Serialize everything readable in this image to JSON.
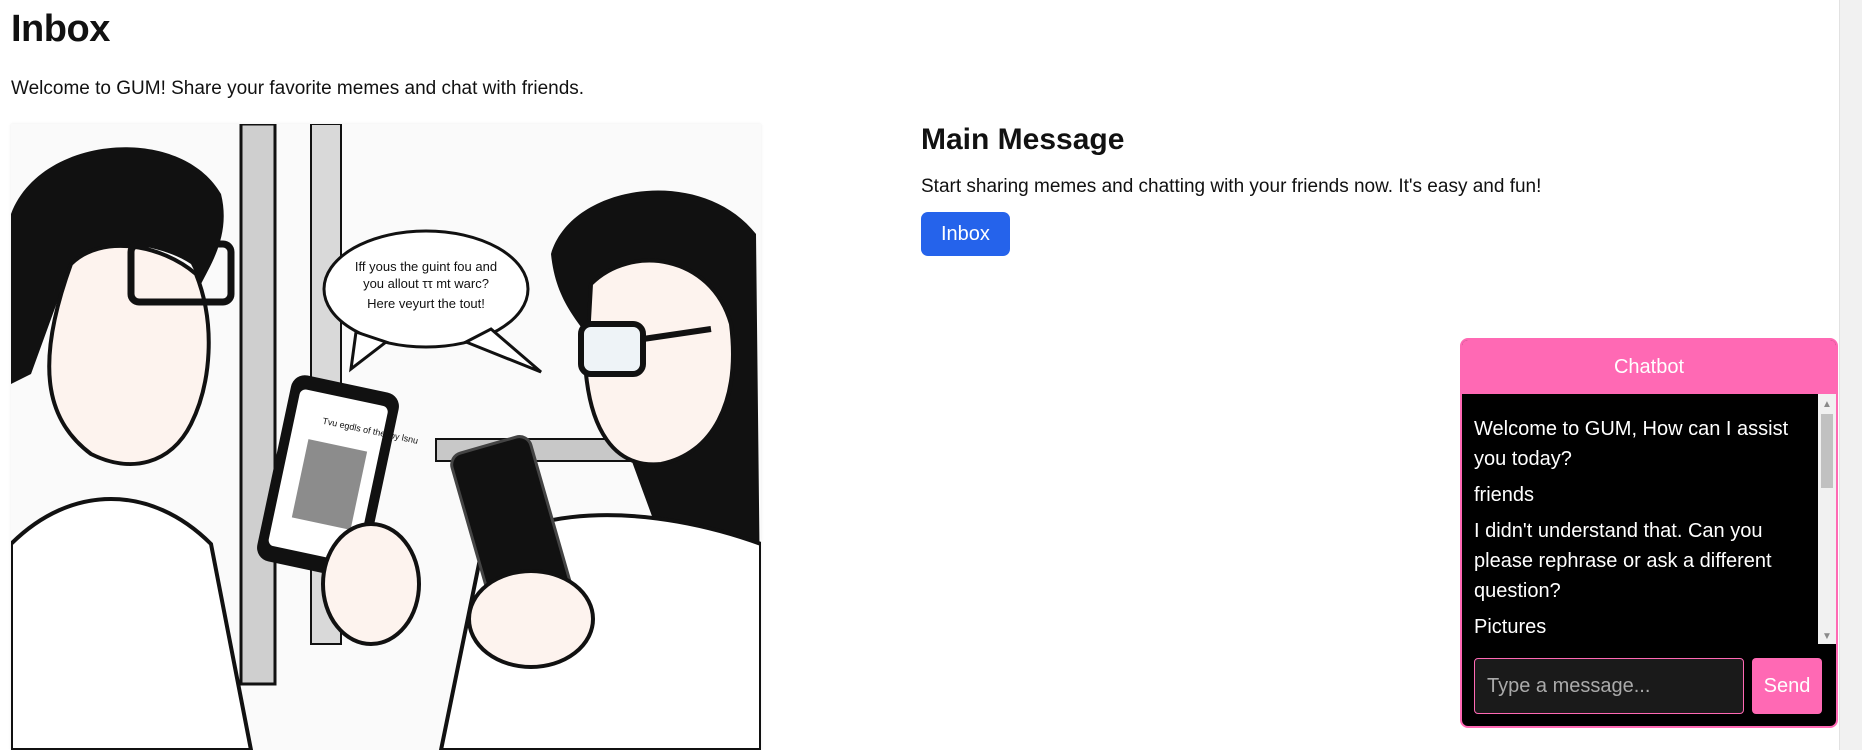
{
  "page": {
    "title": "Inbox",
    "intro": "Welcome to GUM! Share your favorite memes and chat with friends."
  },
  "hero": {
    "bubble_lines": [
      "Iff yous the guint fou and",
      "you allout ττ mt warc?",
      "Here veyurt the tout!"
    ],
    "phone_caption": "Tvu egdls of the toy lsnu"
  },
  "main": {
    "heading": "Main Message",
    "text": "Start sharing memes and chatting with your friends now. It's easy and fun!",
    "button_label": "Inbox"
  },
  "chatbot": {
    "title": "Chatbot",
    "messages": [
      {
        "text": "Welcome to GUM, How can I assist you today?"
      },
      {
        "text": "friends"
      },
      {
        "text": "I didn't understand that. Can you please rephrase or ask a different question?"
      },
      {
        "text": "Pictures"
      }
    ],
    "input_placeholder": "Type a message...",
    "send_label": "Send"
  },
  "colors": {
    "accent_pink": "#ff69b4",
    "button_blue": "#2563eb",
    "chat_background": "#000000"
  },
  "icons": [
    "scroll-up-arrow-icon",
    "scroll-down-arrow-icon"
  ]
}
